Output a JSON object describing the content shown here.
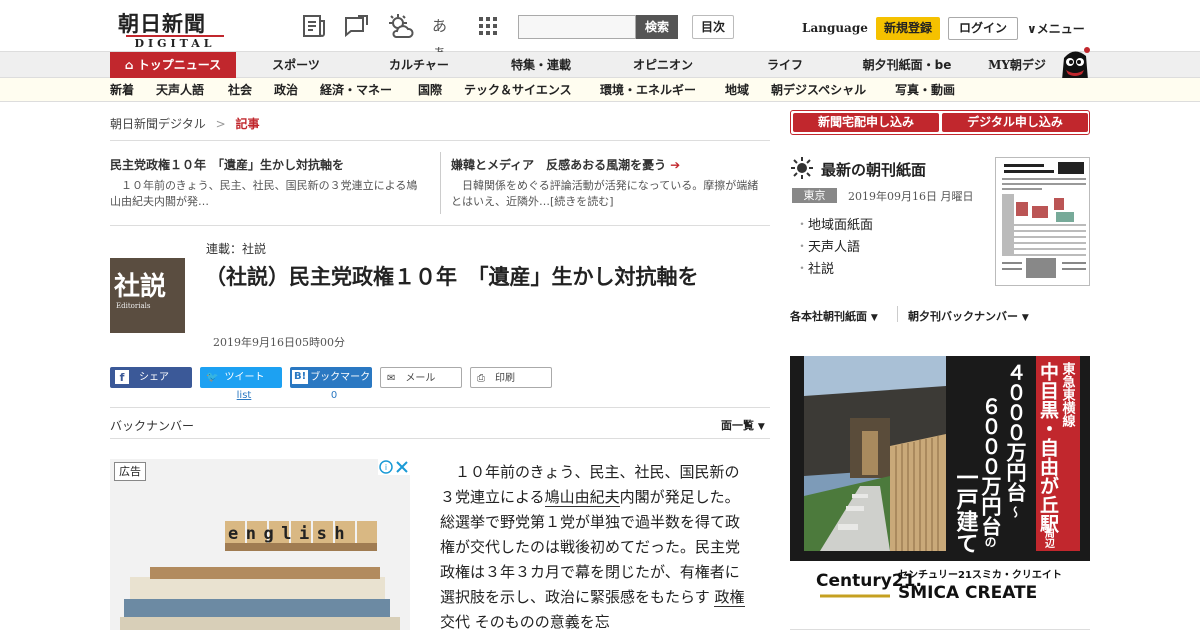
{
  "header": {
    "logo_main": "朝日新聞",
    "logo_sub": "DIGITAL",
    "search_button": "検索",
    "index_button": "目次",
    "language": "Language",
    "register": "新規登録",
    "login": "ログイン",
    "menu": "メニュー",
    "aa_icon": "あぁ"
  },
  "nav_primary": [
    "トップニュース",
    "スポーツ",
    "カルチャー",
    "特集・連載",
    "オピニオン",
    "ライフ",
    "朝夕刊紙面・be",
    "MY朝デジ"
  ],
  "nav_secondary": [
    "新着",
    "天声人語",
    "社会",
    "政治",
    "経済・マネー",
    "国際",
    "テック＆サイエンス",
    "環境・エネルギー",
    "地域",
    "朝デジスペシャル",
    "写真・動画"
  ],
  "breadcrumb": {
    "home": "朝日新聞デジタル",
    "sep": ">",
    "current": "記事"
  },
  "related": [
    {
      "title": "民主党政権１０年　「遺産」生かし対抗軸を",
      "text": "１０年前のきょう、民主、社民、国民新の３党連立による鳩山由紀夫内閣が発…"
    },
    {
      "title": "嫌韓とメディア　反感あおる風潮を憂う",
      "text": "日韓関係をめぐる評論活動が活発になっている。摩擦が端緒とはいえ、近隣外…[続きを読む]"
    }
  ],
  "article": {
    "thumb_main": "社説",
    "thumb_sub": "Editorials",
    "series": "連載：社説",
    "title": "（社説）民主党政権１０年　「遺産」生かし対抗軸を",
    "date": "2019年9月16日05時00分",
    "body_pre": "１０年前のきょう、民主、社民、国民新の３党連立による",
    "body_link": "鳩山由紀夫",
    "body_mid": "内閣が発足した。総選挙で野党第１党が単独で過半数を得て政権が交代したのは戦後初めてだった。民主党政権は３年３カ月で幕を閉じたが、有権者に選択肢を示し、政治に緊張感をもたらす",
    "body_link2": "政権交代",
    "body_post": "そのものの意義を忘"
  },
  "share": {
    "share": "シェア",
    "tweet": "ツイート",
    "bookmark": "ブックマーク",
    "bookmark_icon": "B!",
    "mail": "メール",
    "print": "印刷",
    "tweet_count": "list",
    "bookmark_count": "0"
  },
  "backnumber": {
    "label": "バックナンバー",
    "list": "面一覧"
  },
  "ad_left": {
    "label": "広告",
    "word": "english"
  },
  "sidebar": {
    "sub_home": "新聞宅配申し込み",
    "sub_digital": "デジタル申し込み",
    "morning_title": "最新の朝刊紙面",
    "edition": "東京",
    "date": "2019年09月16日 月曜日",
    "links": [
      "地域面紙面",
      "天声人語",
      "社説"
    ],
    "drop1": "各本社朝刊紙面",
    "drop2": "朝夕刊バックナンバー"
  },
  "ad_right": {
    "line_label": "東急東横線",
    "area": "中目黒・自由が丘駅",
    "area_suffix": "周辺",
    "price1": "４０００万円台",
    "tilde": "～",
    "price2": "６０００万円台",
    "price_suffix": "の",
    "type": "一戸建て",
    "brand_name": "センチュリー21スミカ・クリエイト",
    "brand_en": "SMICA CREATE",
    "brand_logo": "Century21."
  },
  "colors": {
    "accent": "#c1272d",
    "gold": "#f5c100",
    "twitter": "#1da1f2",
    "facebook": "#3b5998",
    "hatena": "#2a78c2"
  }
}
